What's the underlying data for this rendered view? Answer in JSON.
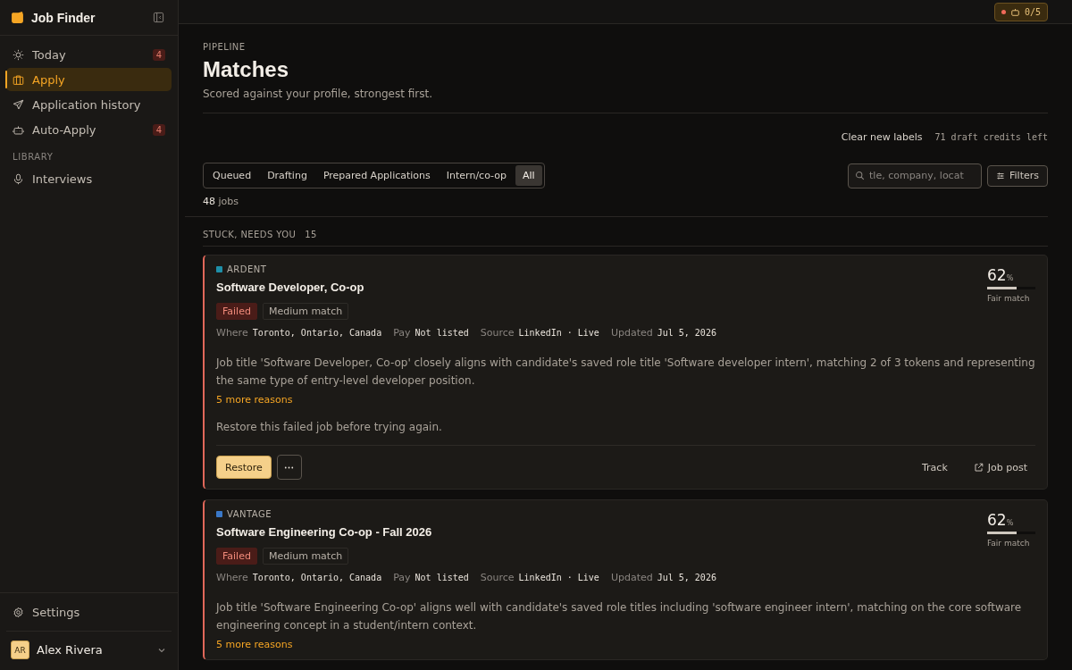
{
  "app": {
    "name": "Job Finder"
  },
  "sidebar": {
    "items": [
      {
        "label": "Today",
        "kind": "today",
        "badge": "4",
        "selected": false
      },
      {
        "label": "Apply",
        "kind": "apply",
        "selected": true
      },
      {
        "label": "Application history",
        "kind": "history",
        "selected": false
      },
      {
        "label": "Auto-Apply",
        "kind": "auto",
        "badge": "4",
        "selected": false
      }
    ],
    "section": "LIBRARY",
    "library_items": [
      {
        "label": "Interviews",
        "selected": false
      }
    ],
    "settings": "Settings",
    "user": {
      "initials": "AR",
      "name": "Alex Rivera"
    }
  },
  "topbar": {
    "auto_apply_status": "0/5"
  },
  "page": {
    "eyebrow": "PIPELINE",
    "title": "Matches",
    "subtitle": "Scored against your profile, strongest first.",
    "clear_labels": "Clear new labels",
    "credits": "71 draft credits left"
  },
  "tabs": [
    {
      "label": "Queued",
      "selected": false
    },
    {
      "label": "Drafting",
      "selected": false
    },
    {
      "label": "Prepared Applications",
      "selected": false
    },
    {
      "label": "Intern/co-op",
      "selected": false
    },
    {
      "label": "All",
      "selected": true
    }
  ],
  "search": {
    "placeholder": "tle, company, locat"
  },
  "filters": "Filters",
  "count": {
    "number": "48",
    "unit": "jobs"
  },
  "group": {
    "title": "STUCK, NEEDS YOU",
    "count": "15"
  },
  "jobs": [
    {
      "company": "ARDENT",
      "color": "#1e8fa8",
      "title": "Software Developer, Co-op",
      "status": "Failed",
      "match": "Medium match",
      "meta": [
        {
          "label": "Where",
          "value": "Toronto, Ontario, Canada"
        },
        {
          "label": "Pay",
          "value": "Not listed"
        },
        {
          "label": "Source",
          "value": "LinkedIn · Live"
        },
        {
          "label": "Updated",
          "value": "Jul 5, 2026"
        }
      ],
      "score": "62",
      "unit": "%",
      "level": 0.62,
      "score_label": "Fair match",
      "reason": "Job title 'Software Developer, Co-op' closely aligns with candidate's saved role title 'Software developer intern', matching 2 of 3 tokens and representing the same type of entry-level developer position.",
      "more": "5 more reasons",
      "note": "Restore this failed job before trying again.",
      "actions": {
        "primary": "Restore",
        "track": "Track",
        "post": "Job post"
      }
    },
    {
      "company": "VANTAGE",
      "color": "#3a78c8",
      "title": "Software Engineering Co-op - Fall 2026",
      "status": "Failed",
      "match": "Medium match",
      "meta": [
        {
          "label": "Where",
          "value": "Toronto, Ontario, Canada"
        },
        {
          "label": "Pay",
          "value": "Not listed"
        },
        {
          "label": "Source",
          "value": "LinkedIn · Live"
        },
        {
          "label": "Updated",
          "value": "Jul 5, 2026"
        }
      ],
      "score": "62",
      "unit": "%",
      "level": 0.62,
      "score_label": "Fair match",
      "reason": "Job title 'Software Engineering Co-op' aligns well with candidate's saved role titles including 'software engineer intern', matching on the core software engineering concept in a student/intern context.",
      "more": "5 more reasons"
    }
  ]
}
